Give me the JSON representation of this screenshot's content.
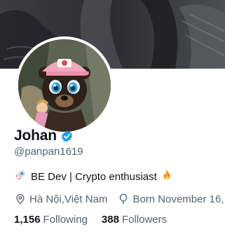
{
  "profile": {
    "display_name": "Johan",
    "verified": true,
    "handle": "@panpan1619",
    "bio_rocket": "🚀",
    "bio_text": "BE Dev | Crypto enthusiast",
    "bio_fire": "🔥",
    "location": "Hà Nội,Việt Nam",
    "birthday": "Born November 16,",
    "following_count": "1,156",
    "following_label": "Following",
    "followers_count": "388",
    "followers_label": "Followers"
  },
  "colors": {
    "verified_blue": "#1d9bf0",
    "secondary_text": "#536471",
    "primary_text": "#0f1419"
  },
  "icons": {
    "verified": "verified-badge-icon",
    "location": "location-pin-icon",
    "birthday": "balloon-icon"
  }
}
